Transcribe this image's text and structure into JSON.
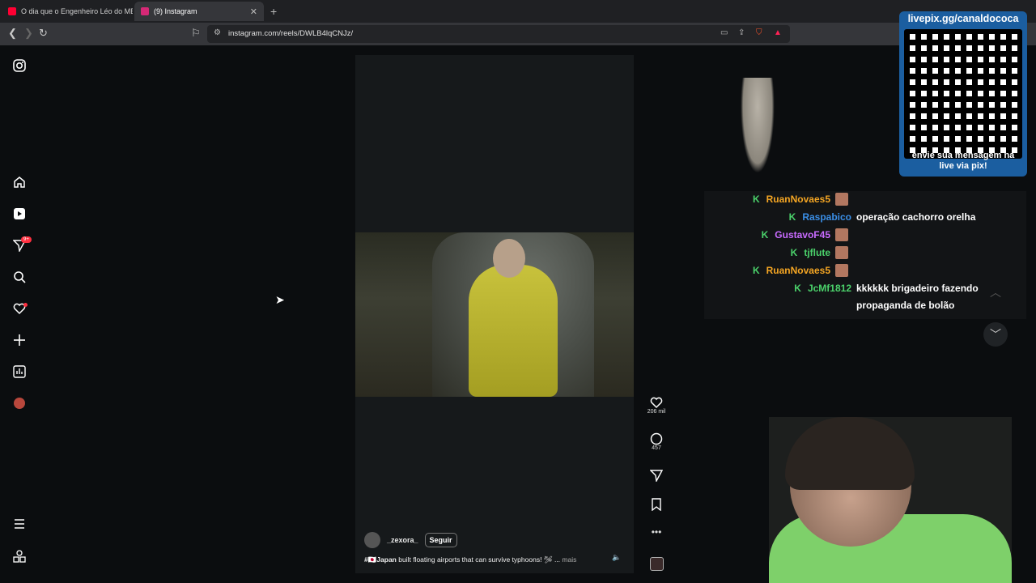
{
  "browser": {
    "tabs": [
      {
        "title": "O dia que o Engenheiro Léo do MBL",
        "active": false
      },
      {
        "title": "(9) Instagram",
        "active": true
      }
    ],
    "new_tab": "+",
    "url": "instagram.com/reels/DWLB4lqCNJz/"
  },
  "instagram": {
    "notifications_badge": "9+",
    "post": {
      "username": "_zexora_",
      "follow_label": "Seguir",
      "caption_tag": "#🇯🇵Japan",
      "caption_text": " built floating airports that can survive typhoons! 🛩 ...",
      "more_label": " mais",
      "likes": "206 mil",
      "comments": "457"
    }
  },
  "stream_overlay": {
    "qr_title": "livepix.gg/canaldococa",
    "qr_footer_line1": "envie sua mensagem na",
    "qr_footer_line2": "live via pix!",
    "chat": [
      {
        "user": "RuanNovaes5",
        "color": "#f5a623",
        "message": ""
      },
      {
        "user": "Raspabico",
        "color": "#3a8ee6",
        "message": "operação cachorro orelha"
      },
      {
        "user": "GustavoF45",
        "color": "#c86bff",
        "message": ""
      },
      {
        "user": "tjflute",
        "color": "#4bd26b",
        "message": ""
      },
      {
        "user": "RuanNovaes5",
        "color": "#f5a623",
        "message": ""
      },
      {
        "user": "JcMf1812",
        "color": "#4bd26b",
        "message": "kkkkkk brigadeiro fazendo propaganda de bolão"
      }
    ]
  }
}
